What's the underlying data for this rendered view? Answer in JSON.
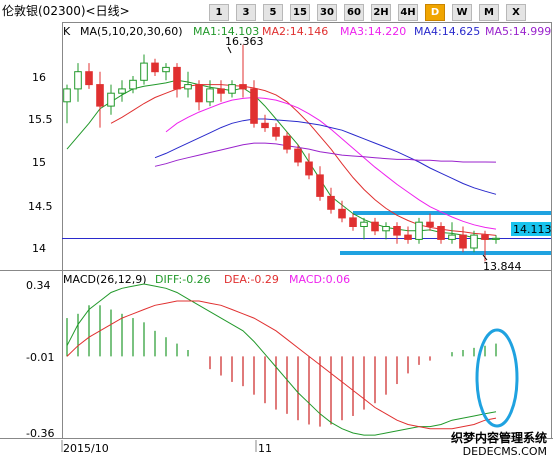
{
  "window": {
    "title": "伦敦银(02300)<日线>"
  },
  "toolbar": {
    "buttons": [
      "1",
      "3",
      "5",
      "15",
      "30",
      "60",
      "2H",
      "4H",
      "D",
      "W",
      "M",
      "X"
    ],
    "active": "D"
  },
  "price_panel": {
    "label": "K",
    "ma_params": "MA(5,10,20,30,60)",
    "legend": [
      {
        "text": "MA1:14.103",
        "color": "#22992b"
      },
      {
        "text": "MA2:14.146",
        "color": "#e03030"
      },
      {
        "text": "MA3:14.220",
        "color": "#ee22ee"
      },
      {
        "text": "MA4:14.625",
        "color": "#2a2acc"
      },
      {
        "text": "MA5:14.999",
        "color": "#9922cc"
      }
    ],
    "y_ticks": [
      "16",
      "15.5",
      "15",
      "14.5",
      "14"
    ],
    "high_label": "16.363",
    "low_label": "13.844",
    "current_price": "14.113"
  },
  "macd_panel": {
    "label": "MACD(26,12,9)",
    "diff": "DIFF:-0.26",
    "dea": "DEA:-0.29",
    "macd": "MACD:0.06",
    "y_ticks": [
      "0.34",
      "-0.01",
      "-0.36"
    ]
  },
  "x_axis": {
    "labels": [
      "2015/10",
      "11"
    ]
  },
  "watermark": {
    "line1": "织梦内容管理系统",
    "line2": "DEDECMS.COM"
  },
  "colors": {
    "up": "#e03030",
    "down": "#22992b",
    "macd_up": "#22992b",
    "macd_down": "#cc2222",
    "highlight": "#1fa2e0",
    "baseline": "#2a2acc"
  },
  "chart_data": [
    {
      "type": "candlestick",
      "title": "伦敦银(02300)<日线>",
      "ylim": [
        13.7,
        16.7
      ],
      "y_ticks": [
        16,
        15.5,
        15,
        14.5,
        14
      ],
      "x_labels": [
        "2015/10",
        "11"
      ],
      "ohlc": [
        [
          15.7,
          15.9,
          15.45,
          15.85
        ],
        [
          15.85,
          16.15,
          15.7,
          16.05
        ],
        [
          16.05,
          16.15,
          15.85,
          15.9
        ],
        [
          15.9,
          16.05,
          15.4,
          15.65
        ],
        [
          15.65,
          15.9,
          15.55,
          15.8
        ],
        [
          15.8,
          15.95,
          15.7,
          15.85
        ],
        [
          15.85,
          16.0,
          15.8,
          15.95
        ],
        [
          15.95,
          16.25,
          15.9,
          16.15
        ],
        [
          16.15,
          16.2,
          16.0,
          16.05
        ],
        [
          16.05,
          16.15,
          15.95,
          16.1
        ],
        [
          16.1,
          16.15,
          15.75,
          15.85
        ],
        [
          15.85,
          16.05,
          15.75,
          15.9
        ],
        [
          15.9,
          15.95,
          15.6,
          15.7
        ],
        [
          15.7,
          15.95,
          15.65,
          15.85
        ],
        [
          15.85,
          15.95,
          15.7,
          15.8
        ],
        [
          15.8,
          15.95,
          15.75,
          15.9
        ],
        [
          15.9,
          16.363,
          15.75,
          15.85
        ],
        [
          15.85,
          15.95,
          15.4,
          15.45
        ],
        [
          15.45,
          15.55,
          15.35,
          15.4
        ],
        [
          15.4,
          15.45,
          15.25,
          15.3
        ],
        [
          15.3,
          15.35,
          15.1,
          15.15
        ],
        [
          15.15,
          15.2,
          14.95,
          15.0
        ],
        [
          15.0,
          15.1,
          14.8,
          14.85
        ],
        [
          14.85,
          14.95,
          14.55,
          14.6
        ],
        [
          14.6,
          14.7,
          14.4,
          14.45
        ],
        [
          14.45,
          14.55,
          14.3,
          14.35
        ],
        [
          14.35,
          14.4,
          14.2,
          14.25
        ],
        [
          14.25,
          14.35,
          14.1,
          14.3
        ],
        [
          14.3,
          14.35,
          14.15,
          14.2
        ],
        [
          14.2,
          14.3,
          14.1,
          14.25
        ],
        [
          14.25,
          14.3,
          14.05,
          14.15
        ],
        [
          14.15,
          14.25,
          14.05,
          14.1
        ],
        [
          14.1,
          14.35,
          14.05,
          14.3
        ],
        [
          14.3,
          14.4,
          14.2,
          14.25
        ],
        [
          14.25,
          14.3,
          14.05,
          14.1
        ],
        [
          14.1,
          14.3,
          14.05,
          14.15
        ],
        [
          14.15,
          14.25,
          13.95,
          14.0
        ],
        [
          14.0,
          14.2,
          13.95,
          14.15
        ],
        [
          14.15,
          14.2,
          13.844,
          14.1
        ],
        [
          14.1,
          14.15,
          14.05,
          14.113
        ]
      ],
      "series": [
        {
          "name": "MA1",
          "values": [
            15.15,
            15.3,
            15.45,
            15.62,
            15.7,
            15.78,
            15.85,
            15.88,
            15.9,
            15.92,
            15.95,
            15.93,
            15.9,
            15.87,
            15.85,
            15.83,
            15.86,
            15.78,
            15.65,
            15.5,
            15.35,
            15.2,
            15.0,
            14.8,
            14.6,
            14.5,
            14.4,
            14.33,
            14.28,
            14.24,
            14.22,
            14.2,
            14.2,
            14.21,
            14.18,
            14.17,
            14.15,
            14.12,
            14.1,
            14.103
          ]
        },
        {
          "name": "MA2",
          "values": [
            null,
            null,
            null,
            null,
            15.45,
            15.52,
            15.6,
            15.68,
            15.75,
            15.8,
            15.85,
            15.88,
            15.9,
            15.9,
            15.9,
            15.89,
            15.88,
            15.86,
            15.83,
            15.78,
            15.7,
            15.58,
            15.45,
            15.3,
            15.15,
            14.98,
            14.82,
            14.68,
            14.56,
            14.46,
            14.38,
            14.32,
            14.27,
            14.24,
            14.22,
            14.2,
            14.19,
            14.17,
            14.16,
            14.146
          ]
        },
        {
          "name": "MA3",
          "values": [
            null,
            null,
            null,
            null,
            null,
            null,
            null,
            null,
            null,
            15.35,
            15.45,
            15.52,
            15.58,
            15.63,
            15.68,
            15.72,
            15.74,
            15.75,
            15.74,
            15.72,
            15.68,
            15.63,
            15.56,
            15.48,
            15.38,
            15.27,
            15.16,
            15.05,
            14.94,
            14.84,
            14.74,
            14.65,
            14.56,
            14.48,
            14.42,
            14.36,
            14.31,
            14.27,
            14.24,
            14.22
          ]
        },
        {
          "name": "MA4",
          "values": [
            null,
            null,
            null,
            null,
            null,
            null,
            null,
            null,
            15.05,
            15.1,
            15.16,
            15.22,
            15.28,
            15.34,
            15.4,
            15.45,
            15.48,
            15.5,
            15.5,
            15.49,
            15.48,
            15.47,
            15.45,
            15.43,
            15.4,
            15.37,
            15.32,
            15.27,
            15.22,
            15.17,
            15.12,
            15.06,
            15.0,
            14.93,
            14.87,
            14.81,
            14.75,
            14.7,
            14.66,
            14.625
          ]
        },
        {
          "name": "MA5",
          "values": [
            null,
            null,
            null,
            null,
            null,
            null,
            null,
            null,
            14.95,
            14.98,
            15.02,
            15.05,
            15.08,
            15.11,
            15.14,
            15.17,
            15.2,
            15.22,
            15.22,
            15.21,
            15.19,
            15.17,
            15.15,
            15.12,
            15.1,
            15.08,
            15.07,
            15.06,
            15.05,
            15.04,
            15.03,
            15.03,
            15.02,
            15.02,
            15.01,
            15.01,
            15.0,
            15.0,
            15.0,
            14.999
          ]
        }
      ]
    },
    {
      "type": "bar",
      "title": "MACD(26,12,9)",
      "ylim": [
        -0.38,
        0.36
      ],
      "y_ticks": [
        0.34,
        -0.01,
        -0.36
      ],
      "series": [
        {
          "name": "DIFF",
          "values": [
            0.05,
            0.15,
            0.22,
            0.26,
            0.3,
            0.32,
            0.33,
            0.34,
            0.33,
            0.32,
            0.3,
            0.27,
            0.24,
            0.21,
            0.18,
            0.15,
            0.12,
            0.07,
            0.01,
            -0.05,
            -0.11,
            -0.17,
            -0.22,
            -0.27,
            -0.31,
            -0.34,
            -0.36,
            -0.37,
            -0.37,
            -0.36,
            -0.35,
            -0.34,
            -0.33,
            -0.33,
            -0.32,
            -0.3,
            -0.29,
            -0.28,
            -0.27,
            -0.26
          ]
        },
        {
          "name": "DEA",
          "values": [
            0.0,
            0.05,
            0.09,
            0.12,
            0.15,
            0.18,
            0.2,
            0.22,
            0.24,
            0.25,
            0.26,
            0.26,
            0.26,
            0.25,
            0.24,
            0.22,
            0.2,
            0.18,
            0.15,
            0.12,
            0.08,
            0.04,
            0.0,
            -0.04,
            -0.08,
            -0.12,
            -0.16,
            -0.2,
            -0.24,
            -0.27,
            -0.3,
            -0.32,
            -0.33,
            -0.34,
            -0.34,
            -0.34,
            -0.33,
            -0.32,
            -0.3,
            -0.29
          ]
        },
        {
          "name": "MACD",
          "values": [
            0.18,
            0.2,
            0.24,
            0.24,
            0.22,
            0.2,
            0.18,
            0.16,
            0.12,
            0.09,
            0.06,
            0.03,
            0.0,
            -0.06,
            -0.09,
            -0.12,
            -0.14,
            -0.18,
            -0.22,
            -0.25,
            -0.27,
            -0.3,
            -0.32,
            -0.33,
            -0.32,
            -0.3,
            -0.28,
            -0.25,
            -0.22,
            -0.18,
            -0.13,
            -0.08,
            -0.04,
            -0.02,
            0.0,
            0.02,
            0.03,
            0.04,
            0.05,
            0.06
          ]
        }
      ]
    }
  ]
}
